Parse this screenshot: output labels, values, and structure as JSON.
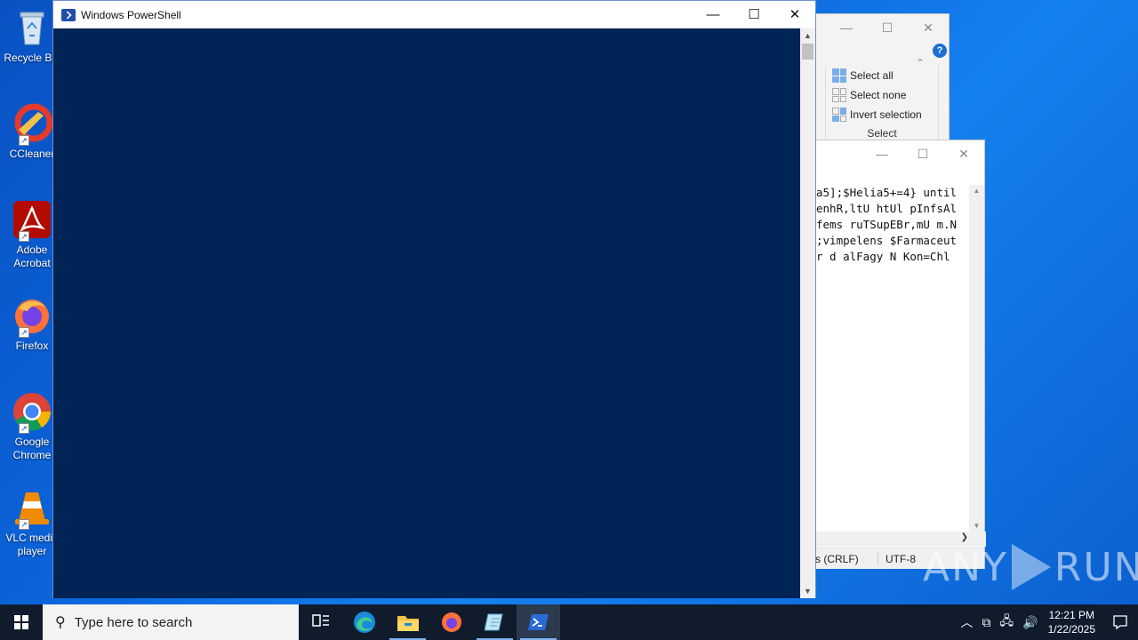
{
  "desktop": {
    "icons": [
      {
        "label": "Recycle Bin",
        "icon": "recycle-bin-icon"
      },
      {
        "label": "CCleaner",
        "icon": "ccleaner-icon"
      },
      {
        "label": "Adobe Acrobat",
        "icon": "adobe-acrobat-icon"
      },
      {
        "label": "Firefox",
        "icon": "firefox-icon"
      },
      {
        "label": "Google Chrome",
        "icon": "google-chrome-icon"
      },
      {
        "label": "VLC media player",
        "icon": "vlc-icon"
      }
    ]
  },
  "explorer": {
    "ribbon": {
      "items": [
        "Select all",
        "Select none",
        "Invert selection"
      ],
      "group_label": "Select"
    }
  },
  "notepad": {
    "lines": [
      "a5];$Helia5+=4} until",
      "enhR,ltU htUl pInfsAl",
      "fems ruTSupEBr,mU m.N",
      ";vimpelens $Farmaceut",
      "r d alFagy N Kon=Chl"
    ],
    "status": {
      "line_ending": "s (CRLF)",
      "encoding": "UTF-8"
    }
  },
  "powershell": {
    "title": "Windows PowerShell",
    "console_bg": "#012456"
  },
  "watermark": {
    "left": "ANY",
    "right": "RUN"
  },
  "taskbar": {
    "search_placeholder": "Type here to search",
    "pinned": [
      "task-view-icon",
      "edge-icon",
      "file-explorer-icon",
      "firefox-icon",
      "notepad-icon",
      "powershell-icon"
    ],
    "active": "powershell-icon",
    "clock": {
      "time": "12:21 PM",
      "date": "1/22/2025"
    }
  }
}
